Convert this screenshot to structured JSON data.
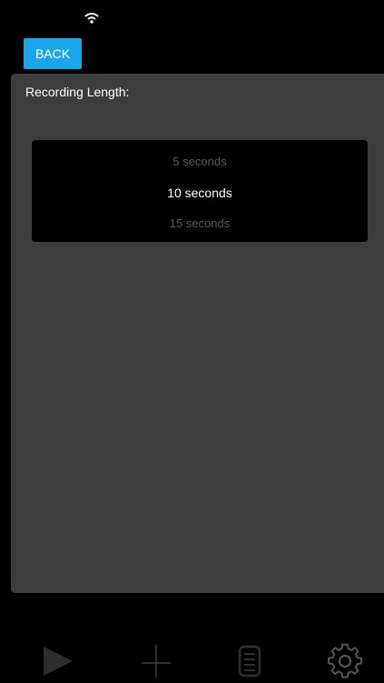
{
  "header": {
    "back_label": "BACK"
  },
  "settings": {
    "recording_length_label": "Recording Length:",
    "picker": {
      "previous": "5 seconds",
      "selected": "10 seconds",
      "next": "15 seconds"
    }
  },
  "tab_bar": {
    "items": [
      {
        "icon": "play-icon"
      },
      {
        "icon": "crosshair-icon"
      },
      {
        "icon": "list-icon"
      },
      {
        "icon": "gear-icon"
      }
    ]
  },
  "colors": {
    "accent": "#1aa6e8",
    "panel": "#3d3d3d",
    "background": "#000000",
    "icon_inactive": "#2e2e2e"
  }
}
